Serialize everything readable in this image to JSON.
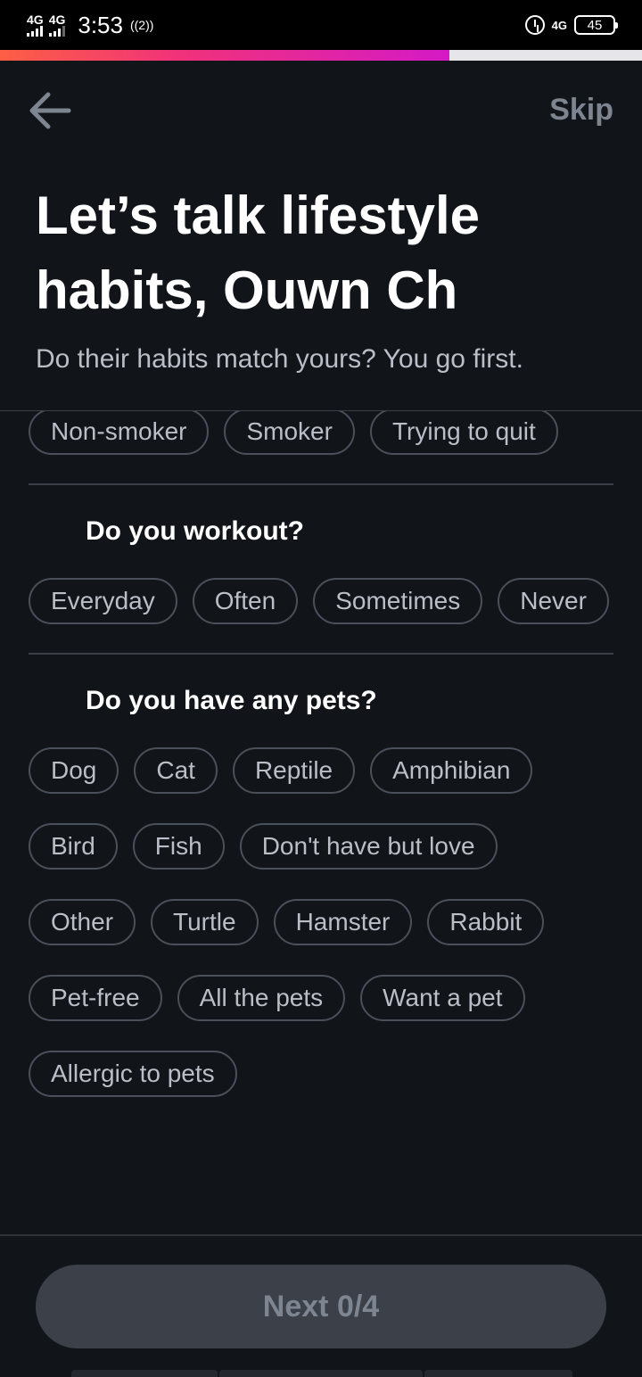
{
  "status_bar": {
    "network_1": "4G",
    "network_2": "4G",
    "time": "3:53",
    "nfc": "((2))",
    "right_network": "4G",
    "battery": "45"
  },
  "progress": {
    "fraction": 0.7
  },
  "header": {
    "back_icon": "arrow-left-icon",
    "skip_label": "Skip",
    "title": "Let’s talk lifestyle habits, Ouwn Ch",
    "subtitle": "Do their habits match yours? You go first."
  },
  "sections": {
    "smoking": {
      "options": [
        "Non-smoker",
        "Smoker",
        "Trying to quit"
      ]
    },
    "workout": {
      "heading": "Do you workout?",
      "options": [
        "Everyday",
        "Often",
        "Sometimes",
        "Never"
      ]
    },
    "pets": {
      "heading": "Do you have any pets?",
      "options": [
        "Dog",
        "Cat",
        "Reptile",
        "Amphibian",
        "Bird",
        "Fish",
        "Don't have but love",
        "Other",
        "Turtle",
        "Hamster",
        "Rabbit",
        "Pet-free",
        "All the pets",
        "Want a pet",
        "Allergic to pets"
      ]
    }
  },
  "footer": {
    "next_label": "Next 0/4"
  },
  "colors": {
    "background": "#111419",
    "chip_border": "#4a505a",
    "chip_text": "#b9bec7",
    "button_disabled": "#3b4049",
    "progress_gradient_start": "#fd5f44",
    "progress_gradient_end": "#d41ac6"
  }
}
